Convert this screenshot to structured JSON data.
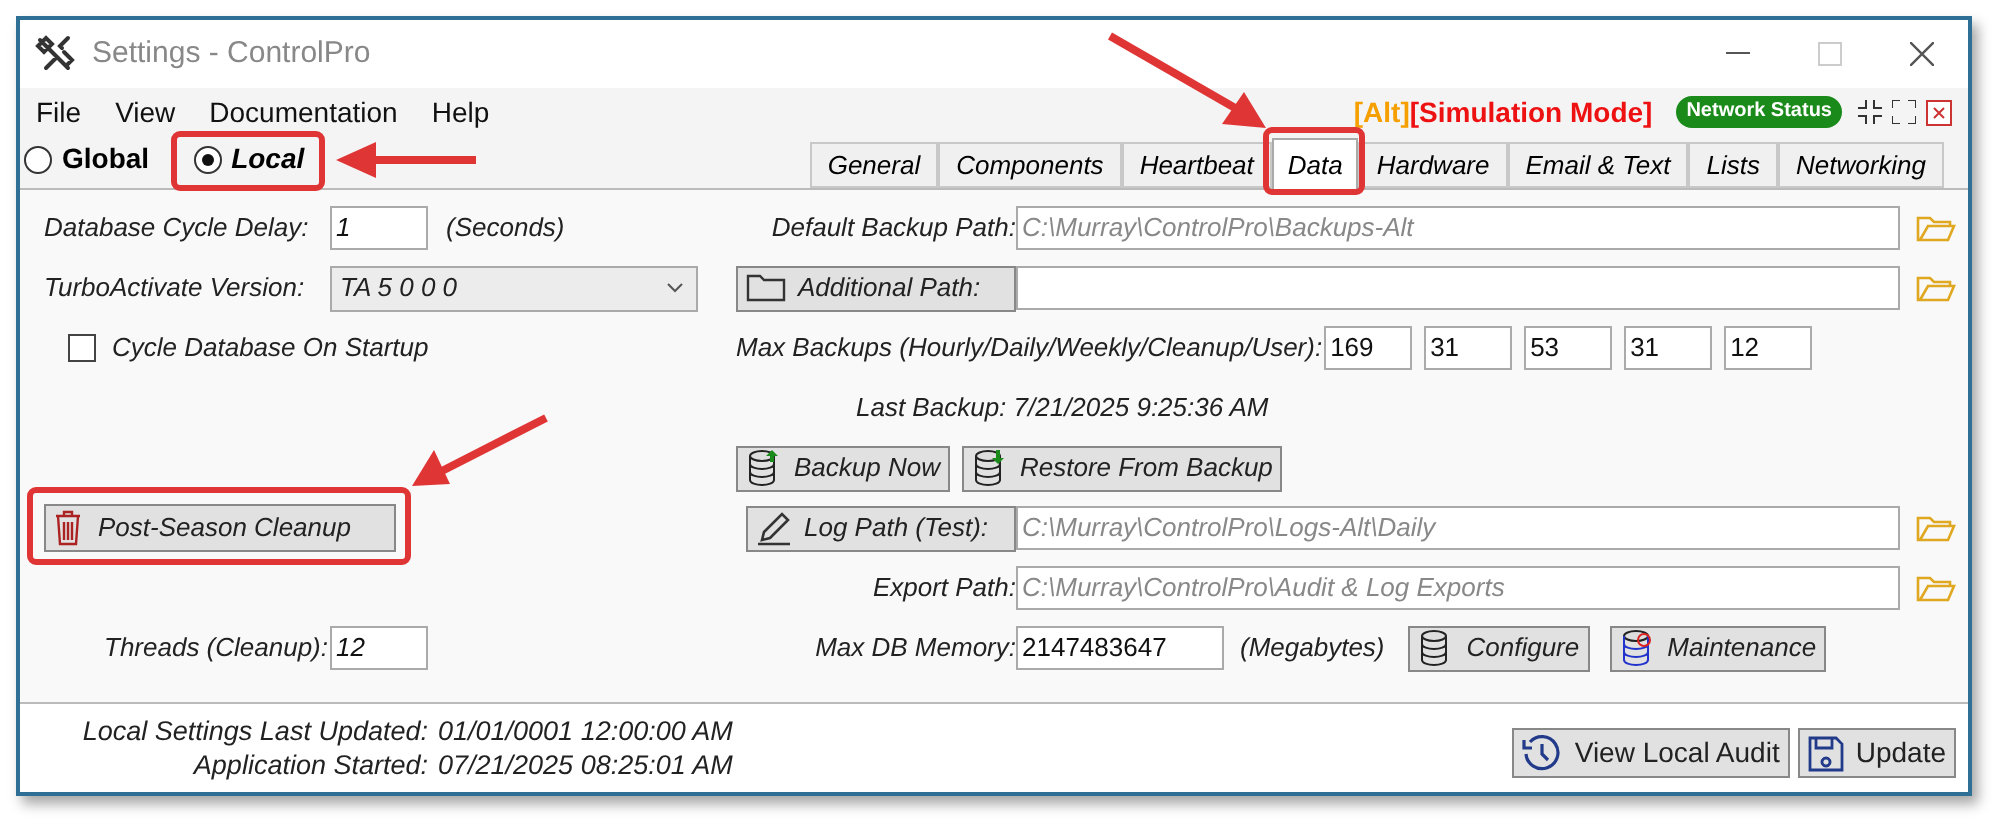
{
  "window": {
    "title": "Settings - ControlPro",
    "minimize_disabled": false,
    "maximize_disabled": true
  },
  "menu": [
    "File",
    "View",
    "Documentation",
    "Help"
  ],
  "mode_tags": [
    {
      "text": "[Alt]",
      "color": "#f5a000"
    },
    {
      "text": "[Simulation Mode]",
      "color": "#ee1111"
    }
  ],
  "network_status": {
    "label": "Network Status",
    "color": "#1a8a1a"
  },
  "scope": [
    {
      "label": "Global",
      "selected": false
    },
    {
      "label": "Local",
      "selected": true
    }
  ],
  "tabs": [
    {
      "label": "General",
      "selected": false
    },
    {
      "label": "Components",
      "selected": false
    },
    {
      "label": "Heartbeat",
      "selected": false
    },
    {
      "label": "Data",
      "selected": true
    },
    {
      "label": "Hardware",
      "selected": false
    },
    {
      "label": "Email & Text",
      "selected": false
    },
    {
      "label": "Lists",
      "selected": false
    },
    {
      "label": "Networking",
      "selected": false
    }
  ],
  "left": {
    "cycle_delay": {
      "label": "Database Cycle Delay:",
      "value": "1",
      "unit": "(Seconds)"
    },
    "turbo": {
      "label": "TurboActivate Version:",
      "value": "TA 5 0 0 0"
    },
    "cycle_on_startup": {
      "label": "Cycle Database On Startup",
      "checked": false
    },
    "cleanup_button": "Post-Season Cleanup",
    "threads": {
      "label": "Threads (Cleanup):",
      "value": "12"
    }
  },
  "right": {
    "default_backup_path": {
      "label": "Default Backup Path:",
      "value": "C:\\Murray\\ControlPro\\Backups-Alt",
      "readonly": true
    },
    "additional_path": {
      "button": "Additional Path:",
      "readonly": false
    },
    "max_backups": {
      "label": "Max Backups (Hourly/Daily/Weekly/Cleanup/User):",
      "values": [
        "169",
        "31",
        "53",
        "31",
        "12"
      ]
    },
    "last_backup": "Last Backup: 7/21/2025 9:25:36 AM",
    "backup_buttons": [
      "Backup Now",
      "Restore From Backup"
    ],
    "log_path": {
      "button": "Log Path (Test):",
      "value": "C:\\Murray\\ControlPro\\Logs-Alt\\Daily",
      "readonly": true
    },
    "export_path": {
      "label": "Export Path:",
      "value": "C:\\Murray\\ControlPro\\Audit & Log Exports",
      "readonly": true
    },
    "max_db_memory": {
      "label": "Max DB Memory:",
      "value": "2147483647",
      "unit": "(Megabytes)"
    },
    "db_buttons": [
      "Configure",
      "Maintenance"
    ]
  },
  "footer": {
    "info": [
      {
        "label": "Local Settings Last Updated:",
        "value": "01/01/0001 12:00:00 AM"
      },
      {
        "label": "Application Started:",
        "value": "07/21/2025 08:25:01 AM"
      }
    ],
    "buttons": [
      "View Local Audit",
      "Update"
    ]
  }
}
